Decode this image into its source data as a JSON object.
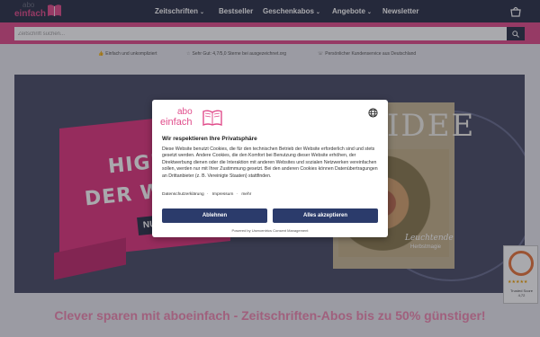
{
  "header": {
    "logo_top": "abo",
    "logo_bottom": "einfach",
    "nav": [
      {
        "label": "Zeitschriften",
        "chevron": true
      },
      {
        "label": "Bestseller",
        "chevron": false
      },
      {
        "label": "Geschenkabos",
        "chevron": true
      },
      {
        "label": "Angebote",
        "chevron": true
      },
      {
        "label": "Newsletter",
        "chevron": false
      }
    ],
    "cart_icon": "cart-icon",
    "brand_color": "#e04d8b",
    "dark_color": "#2b3147"
  },
  "search": {
    "placeholder": "Zeitschrift suchen..."
  },
  "usps": [
    "Einfach und unkompliziert",
    "Sehr Gut: 4,7/5,0 Sterne bei ausgezeichnet.org",
    "Persönlicher Kundenservice aus Deutschland"
  ],
  "hero": {
    "line1": "HIGH",
    "line2": "DER W",
    "badge": "NU",
    "magazine_title": "IDEE",
    "magazine_caption": "Leuchtende",
    "magazine_caption2": "Herbstmagie"
  },
  "trust_badge": {
    "label": "Trusted Score",
    "score": "4,72",
    "stars": "★★★★★"
  },
  "banner_heading": "Clever sparen mit aboeinfach - Zeitschriften-Abos bis zu 50% günstiger!",
  "cookie": {
    "logo_top": "abo",
    "logo_bottom": "einfach",
    "title": "Wir respektieren Ihre Privatsphäre",
    "body": "Diese Website benutzt Cookies, die für den technischen Betrieb der Website erforderlich sind und stets gesetzt werden. Andere Cookies, die den Komfort bei Benutzung dieser Website erhöhen, der Direktwerbung dienen oder die Interaktion mit anderen Websites und sozialen Netzwerken vereinfachen sollen, werden nur mit Ihrer Zustimmung gesetzt. Bei den anderen Cookies können Datenübertragungen an Drittanbieter (z. B. Vereinigte Staaten) stattfinden.",
    "links": [
      "Datenschutzerklärung",
      "Impressum",
      "mehr"
    ],
    "deny_label": "Ablehnen",
    "accept_label": "Alles akzeptieren",
    "powered_by": "Powered by Usercentrics Consent Management"
  }
}
